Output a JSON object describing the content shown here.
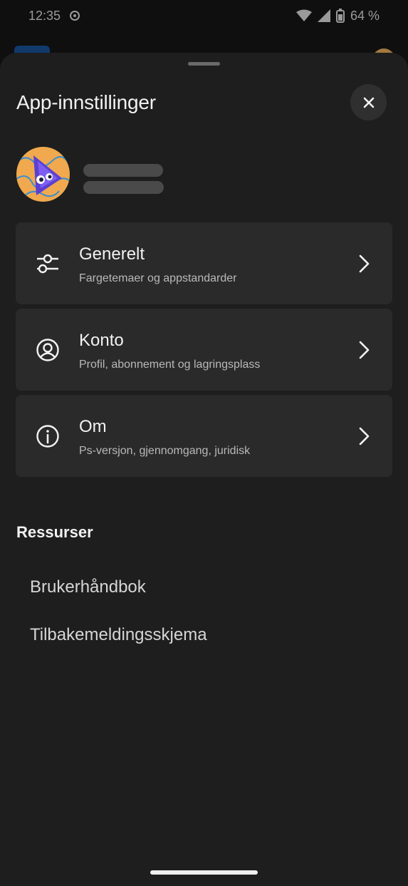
{
  "status": {
    "time": "12:35",
    "battery": "64 %"
  },
  "settings": {
    "title": "App-innstillinger"
  },
  "menu": [
    {
      "label": "Generelt",
      "sub": "Fargetemaer og appstandarder"
    },
    {
      "label": "Konto",
      "sub": "Profil, abonnement og lagringsplass"
    },
    {
      "label": "Om",
      "sub": "Ps-versjon, gjennomgang, juridisk"
    }
  ],
  "resources": {
    "title": "Ressurser",
    "links": [
      "Brukerhåndbok",
      "Tilbakemeldingsskjema"
    ]
  },
  "colors": {
    "background": "#1e1e1e",
    "card": "#2a2a2a",
    "text": "#f2f2f2",
    "subtext": "#b9b9b9"
  },
  "icons": {
    "general": "sliders-icon",
    "account": "user-circle-icon",
    "about": "info-icon",
    "close": "close-icon",
    "chevron": "chevron-right-icon"
  }
}
